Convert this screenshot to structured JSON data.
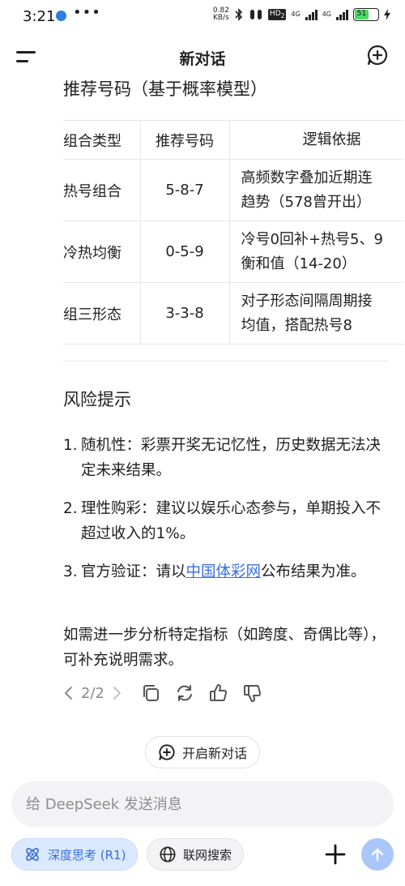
{
  "status_bar": {
    "time": "3:21",
    "dots": "•••",
    "net_speed_value": "0.82",
    "net_speed_unit": "KB/s",
    "hd_label": "HD",
    "hd_sub": "2",
    "sim1_label": "4G",
    "sim2_label": "4G",
    "battery": "51"
  },
  "header": {
    "title": "新对话"
  },
  "recommend": {
    "title": "推荐号码（基于概率模型）",
    "columns": [
      "组合类型",
      "推荐号码",
      "逻辑依据"
    ],
    "rows": [
      {
        "type": "热号组合",
        "number": "5-8-7",
        "reason_line1": "高频数字叠加近期连",
        "reason_line2": "趋势（578曾开出）"
      },
      {
        "type": "冷热均衡",
        "number": "0-5-9",
        "reason_line1": "冷号0回补+热号5、9",
        "reason_line2": "衡和值（14-20）"
      },
      {
        "type": "组三形态",
        "number": "3-3-8",
        "reason_line1": "对子形态间隔周期接",
        "reason_line2": "均值，搭配热号8"
      }
    ]
  },
  "risk": {
    "title": "风险提示",
    "items": [
      {
        "num": "1.",
        "text": "随机性：彩票开奖无记忆性，历史数据无法决定未来结果。"
      },
      {
        "num": "2.",
        "text": "理性购彩：建议以娱乐心态参与，单期投入不超过收入的1%。"
      },
      {
        "num": "3.",
        "text_before": "官方验证：请以",
        "link": "中国体彩网",
        "text_after": "公布结果为准。"
      }
    ]
  },
  "follow_up": "如需进一步分析特定指标（如跨度、奇偶比等），可补充说明需求。",
  "actions": {
    "pager": "2/2"
  },
  "new_chat_pill": {
    "label": "开启新对话"
  },
  "input": {
    "placeholder": "给 DeepSeek 发送消息",
    "value": ""
  },
  "toolbar": {
    "deep_think_label": "深度思考 (R1)",
    "web_search_label": "联网搜索"
  },
  "colors": {
    "accent": "#3a6de0",
    "chip_bg": "#dbe9fe",
    "send_bg": "#aac6fb"
  },
  "icons": {
    "menu": "menu-icon",
    "new_chat": "new-chat-icon",
    "copy": "copy-icon",
    "regenerate": "refresh-icon",
    "like": "thumbs-up-icon",
    "dislike": "thumbs-down-icon",
    "atom": "atom-icon",
    "globe": "globe-icon",
    "plus": "plus-icon",
    "send": "send-arrow-icon"
  }
}
